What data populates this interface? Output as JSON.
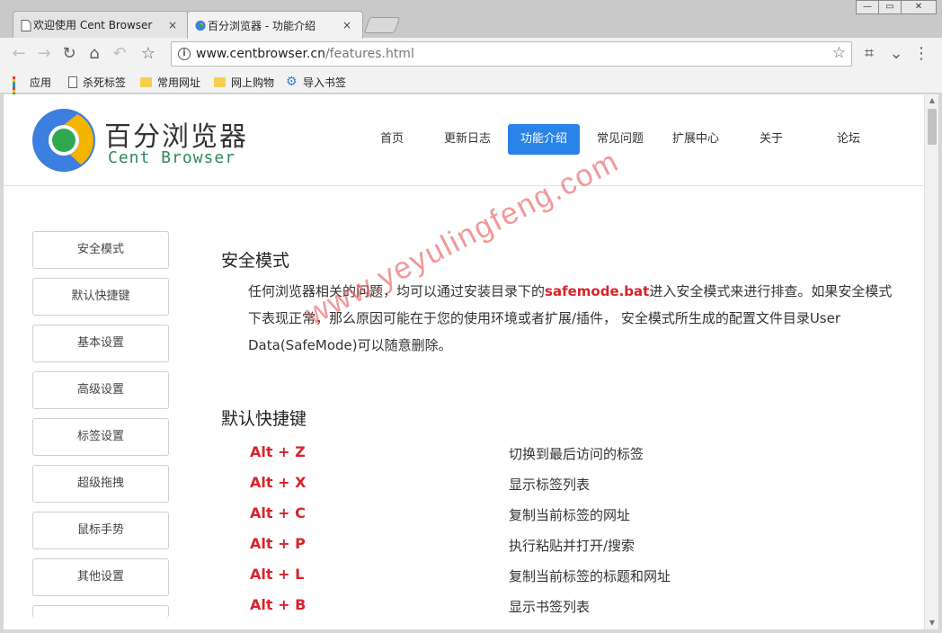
{
  "tabs": [
    {
      "title": "欢迎使用 Cent Browser",
      "close": "×"
    },
    {
      "title": "百分浏览器 - 功能介绍",
      "close": "×"
    }
  ],
  "window_controls": {
    "minimize": "—",
    "maximize": "▭",
    "close": "✕"
  },
  "toolbar": {
    "back": "←",
    "forward": "→",
    "reload": "↻",
    "home": "⌂",
    "undo": "↶",
    "star_left": "☆",
    "url_domain": "www.centbrowser.cn",
    "url_path": "/features.html",
    "omnibox_star": "☆",
    "crop": "⌗",
    "extensions": "⌄",
    "menu": "⋮"
  },
  "bookmarks": [
    {
      "label": "应用",
      "icon": "apps-grid-icon"
    },
    {
      "label": "杀死标签",
      "icon": "page-icon"
    },
    {
      "label": "常用网址",
      "icon": "folder-icon"
    },
    {
      "label": "网上购物",
      "icon": "folder-icon"
    },
    {
      "label": "导入书签",
      "icon": "gear-icon"
    }
  ],
  "site": {
    "brand_cn": "百分浏览器",
    "brand_en": "Cent Browser",
    "nav": [
      "首页",
      "更新日志",
      "功能介绍",
      "常见问题",
      "扩展中心",
      "关于",
      "论坛"
    ],
    "nav_active": "功能介绍"
  },
  "sidebar": [
    "安全模式",
    "默认快捷键",
    "基本设置",
    "高级设置",
    "标签设置",
    "超级拖拽",
    "鼠标手势",
    "其他设置"
  ],
  "content": {
    "section1_title": "安全模式",
    "para_pre": "任何浏览器相关的问题，均可以通过安装目录下的",
    "para_highlight": "safemode.bat",
    "para_post": "进入安全模式来进行排查。如果安全模式下表现正常，那么原因可能在于您的使用环境或者扩展/插件， 安全模式所生成的配置文件目录User Data(SafeMode)可以随意删除。",
    "section2_title": "默认快捷键",
    "shortcuts": [
      {
        "key": "Alt + Z",
        "desc": "切换到最后访问的标签"
      },
      {
        "key": "Alt + X",
        "desc": "显示标签列表"
      },
      {
        "key": "Alt + C",
        "desc": "复制当前标签的网址"
      },
      {
        "key": "Alt + P",
        "desc": "执行粘贴并打开/搜索"
      },
      {
        "key": "Alt + L",
        "desc": "复制当前标签的标题和网址"
      },
      {
        "key": "Alt + B",
        "desc": "显示书签列表"
      }
    ]
  },
  "watermark": "www.yeyulingfeng.com",
  "colors": {
    "accent": "#2a83e8",
    "shortcut_red": "#d8232a",
    "brand_green": "#2d8a5a"
  }
}
